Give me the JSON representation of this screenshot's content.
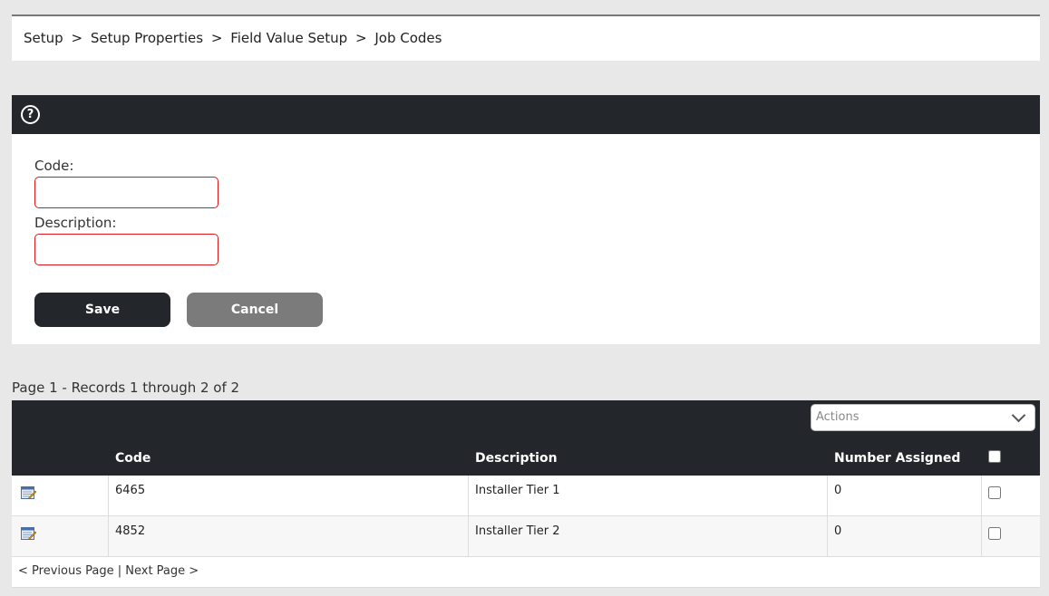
{
  "breadcrumb": {
    "items": [
      "Setup",
      "Setup Properties",
      "Field Value Setup",
      "Job Codes"
    ],
    "separator": ">"
  },
  "form": {
    "help_icon": "?",
    "code_label": "Code:",
    "code_value": "",
    "description_label": "Description:",
    "description_value": "",
    "save_label": "Save",
    "cancel_label": "Cancel"
  },
  "grid": {
    "page_info": "Page 1 - Records 1 through 2 of 2",
    "actions_placeholder": "Actions",
    "columns": [
      "Code",
      "Description",
      "Number Assigned"
    ],
    "rows": [
      {
        "code": "6465",
        "description": "Installer Tier 1",
        "number_assigned": "0"
      },
      {
        "code": "4852",
        "description": "Installer Tier 2",
        "number_assigned": "0"
      }
    ]
  },
  "pager": {
    "previous": "< Previous Page",
    "divider": "|",
    "next": "Next Page >"
  },
  "colors": {
    "header_bg": "#23262b",
    "required_border": "#d9181c",
    "cancel_bg": "#7b7b7b",
    "page_bg": "#e8e8e8"
  }
}
